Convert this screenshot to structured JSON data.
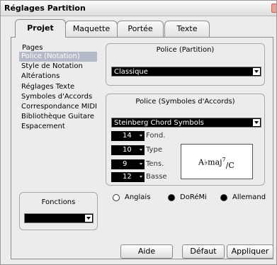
{
  "window": {
    "title": "Réglages Partition"
  },
  "tabs": [
    "Projet",
    "Maquette",
    "Portée",
    "Texte"
  ],
  "pages": {
    "label": "Pages",
    "items": [
      "Police (Notation)",
      "Style de Notation",
      "Altérations",
      "Réglages Texte",
      "Symboles d'Accords",
      "Correspondance MIDI",
      "Bibliothèque Guitare",
      "Espacement"
    ],
    "selected_index": 0
  },
  "functions": {
    "title": "Fonctions",
    "value": ""
  },
  "score_font": {
    "title": "Police (Partition)",
    "value": "Classique"
  },
  "chord_font": {
    "title": "Police (Symboles d'Accords)",
    "value": "Steinberg Chord Symbols",
    "sizes": [
      {
        "value": "14",
        "label": "Fond."
      },
      {
        "value": "10",
        "label": "Type"
      },
      {
        "value": "9",
        "label": "Tens."
      },
      {
        "value": "12",
        "label": "Basse"
      }
    ],
    "preview_main": "A♭maj",
    "preview_sup": "7",
    "preview_bass": "/C"
  },
  "notation_radios": [
    {
      "label": "Anglais",
      "selected": false
    },
    {
      "label": "DoRéMi",
      "selected": true
    },
    {
      "label": "Allemand",
      "selected": true
    }
  ],
  "buttons": {
    "help": "Aide",
    "default": "Défaut",
    "apply": "Appliquer"
  }
}
